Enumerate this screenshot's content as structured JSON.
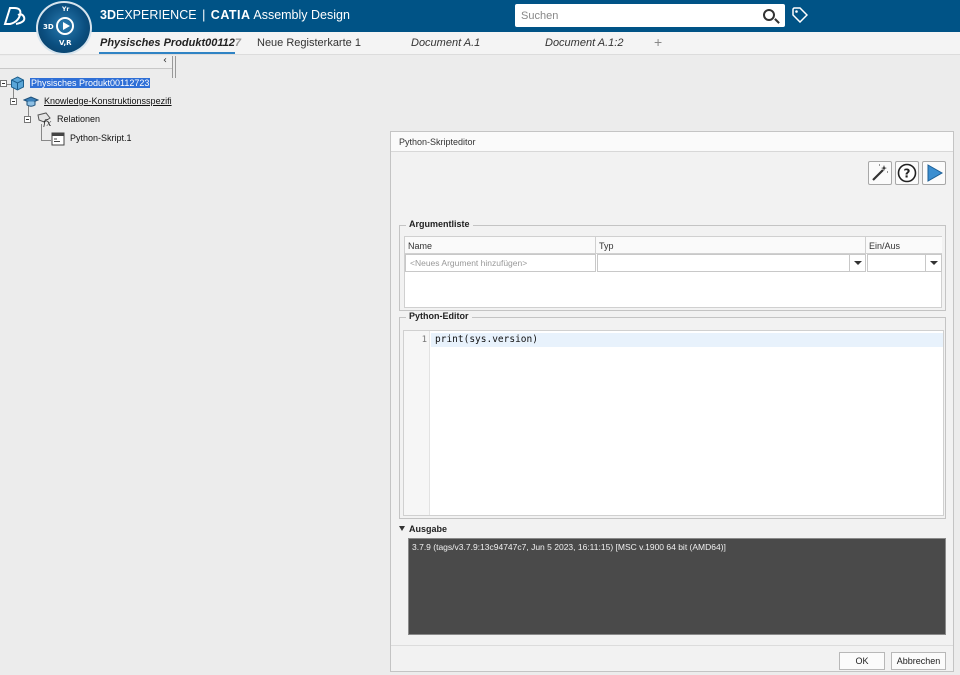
{
  "app": {
    "brand_bold": "3D",
    "brand_rest": "EXPERIENCE",
    "separator": "|",
    "product": "CATIA",
    "app_name": "Assembly Design",
    "compass_labels": [
      "3D",
      "V,R"
    ]
  },
  "search": {
    "placeholder": "Suchen"
  },
  "tabs": [
    {
      "label": "Physisches Produkt00112",
      "fade": "7",
      "active": true
    },
    {
      "label": "Neue Registerkarte 1"
    },
    {
      "label": "Document A.1"
    },
    {
      "label": "Document A.1:2"
    },
    {
      "label": "+"
    }
  ],
  "tree": {
    "collapse_label": "‹",
    "nodes": [
      {
        "label": "Physisches Produkt00112723",
        "selected": true,
        "icon": "product-icon"
      },
      {
        "label": "Knowledge-Konstruktionsspezifi",
        "icon": "knowledge-spec-icon"
      },
      {
        "label": "Relationen",
        "icon": "relations-icon"
      },
      {
        "label": "Python-Skript.1",
        "icon": "python-script-icon"
      }
    ]
  },
  "dialog": {
    "title": "Python-Skripteditor",
    "argument_list": {
      "title": "Argumentliste",
      "columns": [
        "Name",
        "Typ",
        "Ein/Aus"
      ],
      "new_row_placeholder": "<Neues Argument hinzufügen>"
    },
    "python_editor": {
      "title": "Python-Editor",
      "lines": [
        {
          "number": "1",
          "code": "print(sys.version)"
        }
      ]
    },
    "output": {
      "title": "Ausgabe",
      "text": "3.7.9 (tags/v3.7.9:13c94747c7, Jun  5 2023, 16:11:15) [MSC v.1900 64 bit (AMD64)]"
    },
    "buttons": {
      "ok": "OK",
      "cancel": "Abbrechen"
    }
  },
  "colors": {
    "topbar": "#005386",
    "accent": "#2f83c4",
    "selection": "#2f6fd6",
    "console_bg": "#4a4a4a"
  }
}
